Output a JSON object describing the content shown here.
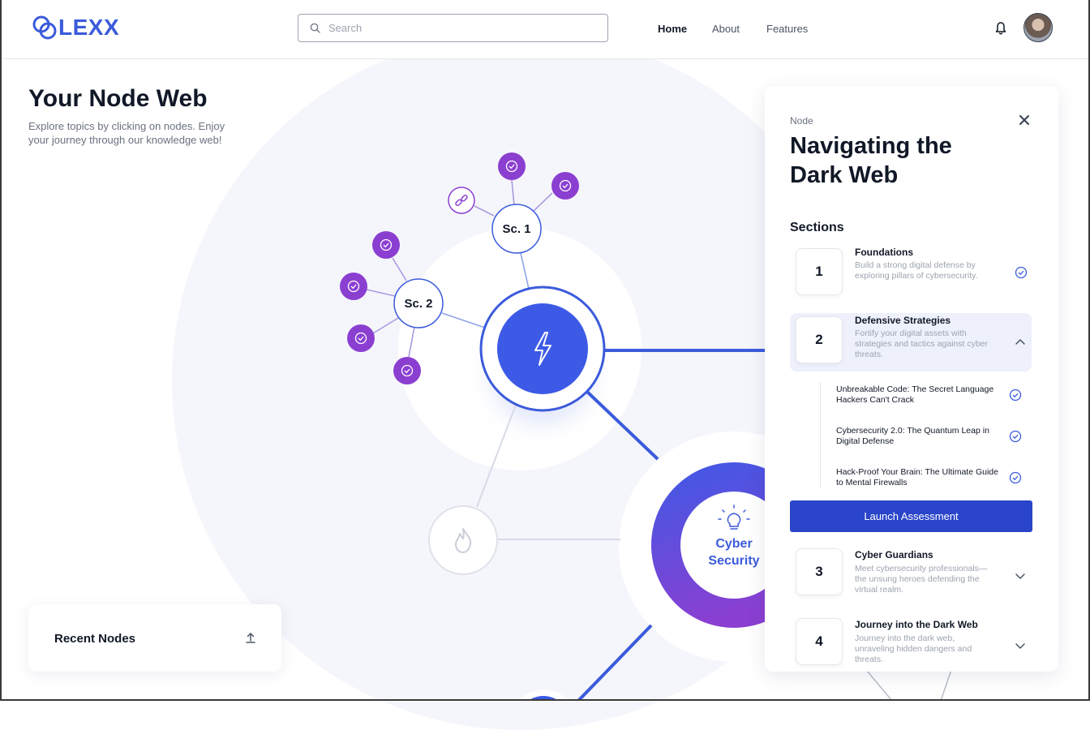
{
  "app": {
    "brand": "LEXX"
  },
  "search": {
    "placeholder": "Search"
  },
  "nav": {
    "items": [
      {
        "label": "Home"
      },
      {
        "label": "About"
      },
      {
        "label": "Features"
      }
    ]
  },
  "page": {
    "title": "Your Node Web",
    "subtitle": "Explore topics by clicking on nodes. Enjoy your journey through our knowledge web!"
  },
  "graph": {
    "subcluster_1_label": "Sc. 1",
    "subcluster_2_label": "Sc. 2",
    "topic_label": "Cyber Security",
    "colors": {
      "accent": "#3b5bdb",
      "purple": "#8b3fd1",
      "node_bg": "#ffffff"
    }
  },
  "recent": {
    "title": "Recent Nodes"
  },
  "panel": {
    "kicker": "Node",
    "title": "Navigating the Dark Web",
    "sections_label": "Sections",
    "sections": [
      {
        "number": "1",
        "title": "Foundations",
        "description": "Build a strong digital defense by exploring  pillars of cybersecurity.",
        "state": "completed"
      },
      {
        "number": "2",
        "title": "Defensive Strategies",
        "description": "Fortify your digital assets with strategies and tactics against cyber threats.",
        "state": "expanded"
      },
      {
        "number": "3",
        "title": "Cyber Guardians",
        "description": "Meet cybersecurity professionals—the unsung heroes defending the virtual realm.",
        "state": "collapsed"
      },
      {
        "number": "4",
        "title": "Journey into the Dark Web",
        "description": "Journey into the dark web, unraveling hidden dangers and threats.",
        "state": "collapsed"
      }
    ],
    "subsections": [
      {
        "title": "Unbreakable Code: The Secret Language Hackers Can't Crack"
      },
      {
        "title": "Cybersecurity 2.0: The Quantum Leap in Digital Defense"
      },
      {
        "title": "Hack-Proof Your Brain: The Ultimate Guide to Mental Firewalls"
      }
    ],
    "launch_label": "Launch Assessment"
  }
}
